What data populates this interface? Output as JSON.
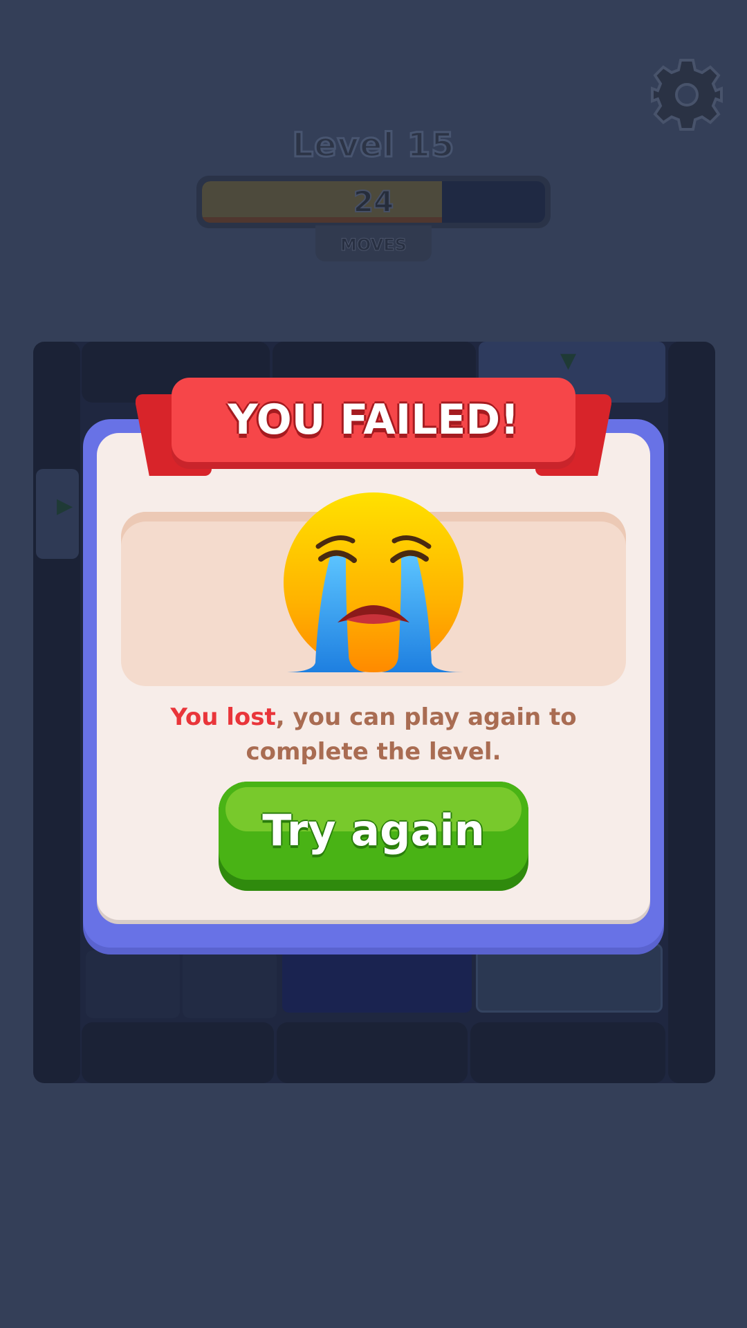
{
  "hud": {
    "level_title": "Level 15",
    "moves_count": "24",
    "moves_label": "MOVES",
    "moves_progress": 0.7,
    "settings_icon": "gear-icon"
  },
  "dialog": {
    "title": "YOU FAILED!",
    "emoji_icon": "loudly-crying-face-icon",
    "message_highlight": "You lost",
    "message_rest": ", you can play again to complete the level.",
    "button_label": "Try again"
  },
  "colors": {
    "background": "#343f58",
    "dialog_border": "#6872e6",
    "ribbon": "#f64649",
    "button": "#49b315",
    "lost_text": "#e9353a"
  }
}
